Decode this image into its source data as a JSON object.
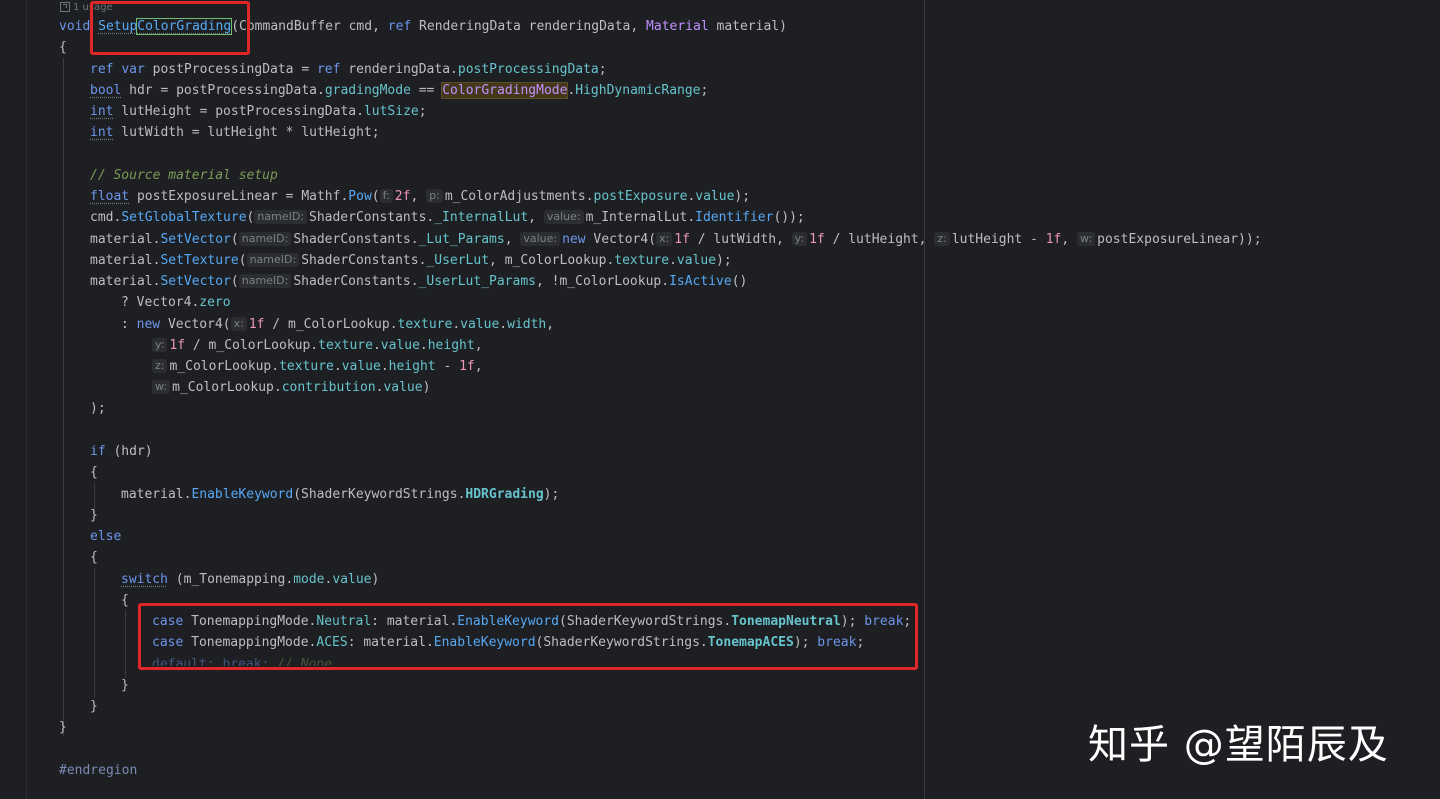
{
  "usage_hint": "1 usage",
  "watermark": "知乎 @望陌辰及",
  "code": {
    "sig": {
      "kw_void": "void",
      "fn_setup": "Setup",
      "fn_grading": "ColorGrading",
      "p1": "(CommandBuffer cmd, ",
      "kw_ref": "ref",
      "p2": " RenderingData renderingData, ",
      "t_material": "Material",
      "p3": " material)"
    },
    "brace_open": "{",
    "l1": {
      "ref": "ref",
      "var": "var",
      "a": " postProcessingData = ",
      "ref2": "ref",
      "b": " renderingData.",
      "f": "postProcessingData",
      "c": ";"
    },
    "l2": {
      "bool": "bool",
      "a": " hdr = postProcessingData.",
      "f": "gradingMode",
      "b": " == ",
      "e": "ColorGradingMode",
      "dot": ".",
      "v": "HighDynamicRange",
      "c": ";"
    },
    "l3": {
      "int": "int",
      "a": " lutHeight = postProcessingData.",
      "f": "lutSize",
      "c": ";"
    },
    "l4": {
      "int": "int",
      "a": " lutWidth = lutHeight * lutHeight;"
    },
    "comment": "// Source material setup",
    "l5": {
      "float": "float",
      "a": " postExposureLinear = Mathf.",
      "m": "Pow",
      "b": "(",
      "h1": "f:",
      "n": "2f",
      "c": ", ",
      "h2": "p:",
      "d": "m_ColorAdjustments.",
      "f1": "postExposure",
      "dot": ".",
      "f2": "value",
      "e": ");"
    },
    "l6": {
      "a": "cmd.",
      "m": "SetGlobalTexture",
      "b": "(",
      "h1": "nameID:",
      "c": "ShaderConstants.",
      "f": "_InternalLut",
      "d": ", ",
      "h2": "value:",
      "e": "m_InternalLut.",
      "m2": "Identifier",
      "g": "());"
    },
    "l7": {
      "a": "material.",
      "m": "SetVector",
      "b": "(",
      "h1": "nameID:",
      "c": "ShaderConstants.",
      "f": "_Lut_Params",
      "d": ", ",
      "h2": "value:",
      "new": "new",
      "e": " Vector4(",
      "h3": "x:",
      "n1": "1f",
      "g": " / lutWidth, ",
      "h4": "y:",
      "n2": "1f",
      "h": " / lutHeight, ",
      "h5": "z:",
      "i": "lutHeight - ",
      "n3": "1f",
      "j": ", ",
      "h6": "w:",
      "k": "postExposureLinear));"
    },
    "l8": {
      "a": "material.",
      "m": "SetTexture",
      "b": "(",
      "h1": "nameID:",
      "c": "ShaderConstants.",
      "f": "_UserLut",
      "d": ", m_ColorLookup.",
      "f1": "texture",
      "dot": ".",
      "f2": "value",
      "e": ");"
    },
    "l9": {
      "a": "material.",
      "m": "SetVector",
      "b": "(",
      "h1": "nameID:",
      "c": "ShaderConstants.",
      "f": "_UserLut_Params",
      "d": ", !m_ColorLookup.",
      "m2": "IsActive",
      "e": "()"
    },
    "l10": {
      "a": "? Vector4.",
      "f": "zero"
    },
    "l11": {
      "a": ": ",
      "new": "new",
      "b": " Vector4(",
      "h": "x:",
      "n": "1f",
      "c": " / m_ColorLookup.",
      "f1": "texture",
      "d1": ".",
      "f2": "value",
      "d2": ".",
      "f3": "width",
      "e": ","
    },
    "l12": {
      "h": "y:",
      "n": "1f",
      "c": " / m_ColorLookup.",
      "f1": "texture",
      "d1": ".",
      "f2": "value",
      "d2": ".",
      "f3": "height",
      "e": ","
    },
    "l13": {
      "h": "z:",
      "c": "m_ColorLookup.",
      "f1": "texture",
      "d1": ".",
      "f2": "value",
      "d2": ".",
      "f3": "height",
      "e": " - ",
      "n": "1f",
      "g": ","
    },
    "l14": {
      "h": "w:",
      "c": "m_ColorLookup.",
      "f1": "contribution",
      "d1": ".",
      "f2": "value",
      "e": ")"
    },
    "l15": ");",
    "if_line": {
      "kw": "if",
      "a": " (hdr)"
    },
    "brace1": "{",
    "l16": {
      "a": "material.",
      "m": "EnableKeyword",
      "b": "(ShaderKeywordStrings.",
      "f": "HDRGrading",
      "c": ");"
    },
    "brace2": "}",
    "else_kw": "else",
    "brace3": "{",
    "sw": {
      "kw": "switch",
      "a": " (m_Tonemapping.",
      "f1": "mode",
      "d": ".",
      "f2": "value",
      "b": ")"
    },
    "brace4": "{",
    "c1": {
      "kw": "case",
      "a": " TonemappingMode.",
      "e": "Neutral",
      "b": ": material.",
      "m": "EnableKeyword",
      "c": "(ShaderKeywordStrings.",
      "f": "TonemapNeutral",
      "d": "); ",
      "brk": "break",
      "g": ";"
    },
    "c2": {
      "kw": "case",
      "a": " TonemappingMode.",
      "e": "ACES",
      "b": ": material.",
      "m": "EnableKeyword",
      "c": "(ShaderKeywordStrings.",
      "f": "TonemapACES",
      "d": "); ",
      "brk": "break",
      "g": ";"
    },
    "c3": {
      "kw": "default:",
      "brk": " break;",
      "cmt": " // None"
    },
    "brace5": "}",
    "brace6": "}",
    "brace7": "}",
    "endregion": "#endregion"
  }
}
